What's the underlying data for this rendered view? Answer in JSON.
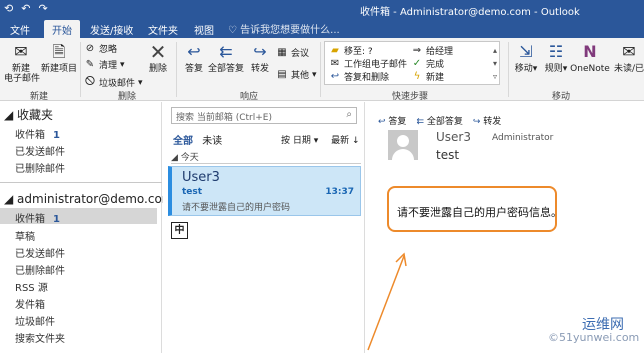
{
  "window": {
    "title": "收件箱 - Administrator@demo.com - Outlook",
    "qat": [
      "⟲",
      "↶",
      "↷"
    ],
    "controls": [
      "—",
      "❐",
      "✕"
    ]
  },
  "tabs": [
    {
      "label": "文件"
    },
    {
      "label": "开始"
    },
    {
      "label": "发送/接收"
    },
    {
      "label": "文件夹"
    },
    {
      "label": "视图"
    }
  ],
  "tell_me": "♡ 告诉我您想要做什么...",
  "ribbon": {
    "new_email": "新建\n电子邮件",
    "new_email_l1": "新建",
    "new_email_l2": "电子邮件",
    "new_items": "新建项目",
    "group_new": "新建",
    "ignore": "忽略",
    "clean": "清理",
    "junk": "垃圾邮件",
    "delete": "删除",
    "group_delete": "删除",
    "reply": "答复",
    "reply_all": "全部答复",
    "forward": "转发",
    "meeting": "会议",
    "more": "其他",
    "group_respond": "响应",
    "quick": [
      "移至: ?",
      "工作组电子邮件",
      "答复和删除",
      "给经理",
      "完成",
      "新建"
    ],
    "group_quick": "快速步骤",
    "move": "移动",
    "rules": "规则",
    "onenote": "OneNote",
    "unread": "未读/已",
    "group_move": "移动"
  },
  "nav": {
    "favorites": "收藏夹",
    "fav_items": [
      {
        "label": "收件箱",
        "count": "1"
      },
      {
        "label": "已发送邮件",
        "count": ""
      },
      {
        "label": "已删除邮件",
        "count": ""
      }
    ],
    "account": "administrator@demo.com",
    "acc_items": [
      {
        "label": "收件箱",
        "count": "1"
      },
      {
        "label": "草稿",
        "count": ""
      },
      {
        "label": "已发送邮件",
        "count": ""
      },
      {
        "label": "已删除邮件",
        "count": ""
      },
      {
        "label": "RSS 源",
        "count": ""
      },
      {
        "label": "发件箱",
        "count": ""
      },
      {
        "label": "垃圾邮件",
        "count": ""
      },
      {
        "label": "搜索文件夹",
        "count": ""
      }
    ]
  },
  "list": {
    "search_placeholder": "搜索 当前邮箱 (Ctrl+E)",
    "search_scope": "当前邮箱 ▾",
    "filter_all": "全部",
    "filter_unread": "未读",
    "sort_by": "按 日期 ▾",
    "sort_order": "最新 ↓",
    "group_today": "◢ 今天",
    "item": {
      "sender": "User3",
      "subject": "test",
      "time": "13:37",
      "preview": "请不要泄露自己的用户密码"
    },
    "ime": "中"
  },
  "reading": {
    "reply": "答复",
    "reply_all": "全部答复",
    "forward": "转发",
    "sender": "User3",
    "to": "Administrator",
    "subject": "test",
    "body": "请不要泄露自己的用户密码信息。"
  },
  "watermark": {
    "line1": "运维网",
    "line2": "©51yunwei.com"
  }
}
